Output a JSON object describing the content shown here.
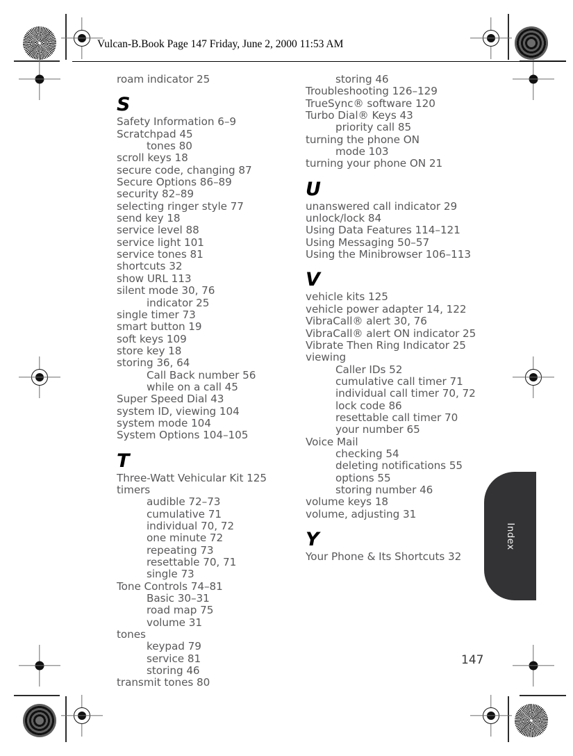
{
  "header": {
    "text": "Vulcan-B.Book  Page 147  Friday, June 2, 2000  11:53 AM"
  },
  "folio": {
    "page_number": "147"
  },
  "thumb_tab": {
    "label": "Index"
  },
  "index": {
    "left_column": [
      {
        "type": "entry",
        "text": "roam indicator 25"
      },
      {
        "type": "letter",
        "text": "S"
      },
      {
        "type": "entry",
        "text": "Safety Information 6–9"
      },
      {
        "type": "entry",
        "text": "Scratchpad 45"
      },
      {
        "type": "sub",
        "text": "tones 80"
      },
      {
        "type": "entry",
        "text": "scroll keys 18"
      },
      {
        "type": "entry",
        "text": "secure code, changing 87"
      },
      {
        "type": "entry",
        "text": "Secure Options 86–89"
      },
      {
        "type": "entry",
        "text": "security 82–89"
      },
      {
        "type": "entry",
        "text": "selecting ringer style 77"
      },
      {
        "type": "entry",
        "text": "send key 18"
      },
      {
        "type": "entry",
        "text": "service level 88"
      },
      {
        "type": "entry",
        "text": "service light 101"
      },
      {
        "type": "entry",
        "text": "service tones 81"
      },
      {
        "type": "entry",
        "text": "shortcuts 32"
      },
      {
        "type": "entry",
        "text": "show URL 113"
      },
      {
        "type": "entry",
        "text": "silent mode 30, 76"
      },
      {
        "type": "sub",
        "text": "indicator 25"
      },
      {
        "type": "entry",
        "text": "single timer 73"
      },
      {
        "type": "entry",
        "text": "smart button 19"
      },
      {
        "type": "entry",
        "text": "soft keys 109"
      },
      {
        "type": "entry",
        "text": "store key 18"
      },
      {
        "type": "entry",
        "text": "storing 36, 64"
      },
      {
        "type": "sub",
        "text": "Call Back number 56"
      },
      {
        "type": "sub",
        "text": "while on a call 45"
      },
      {
        "type": "entry",
        "text": "Super Speed Dial 43"
      },
      {
        "type": "entry",
        "text": "system ID, viewing 104"
      },
      {
        "type": "entry",
        "text": "system mode 104"
      },
      {
        "type": "entry",
        "text": "System Options 104–105"
      },
      {
        "type": "letter",
        "text": "T"
      },
      {
        "type": "entry",
        "text": "Three-Watt Vehicular Kit 125"
      },
      {
        "type": "entry",
        "text": "timers"
      },
      {
        "type": "sub",
        "text": "audible 72–73"
      },
      {
        "type": "sub",
        "text": "cumulative 71"
      },
      {
        "type": "sub",
        "text": "individual 70, 72"
      },
      {
        "type": "sub",
        "text": "one minute 72"
      },
      {
        "type": "sub",
        "text": "repeating 73"
      },
      {
        "type": "sub",
        "text": "resettable 70, 71"
      },
      {
        "type": "sub",
        "text": "single 73"
      },
      {
        "type": "entry",
        "text": "Tone Controls 74–81"
      },
      {
        "type": "sub",
        "text": "Basic 30–31"
      },
      {
        "type": "sub",
        "text": "road map 75"
      },
      {
        "type": "sub",
        "text": "volume 31"
      },
      {
        "type": "entry",
        "text": "tones"
      },
      {
        "type": "sub",
        "text": "keypad 79"
      },
      {
        "type": "sub",
        "text": "service 81"
      },
      {
        "type": "sub",
        "text": "storing 46"
      },
      {
        "type": "entry",
        "text": "transmit tones 80"
      }
    ],
    "right_column": [
      {
        "type": "sub",
        "text": "storing 46"
      },
      {
        "type": "entry",
        "text": "Troubleshooting 126–129"
      },
      {
        "type": "entry",
        "text": "TrueSync® software 120"
      },
      {
        "type": "entry",
        "text": "Turbo Dial® Keys 43"
      },
      {
        "type": "sub",
        "text": "priority call 85"
      },
      {
        "type": "entry",
        "text": "turning the phone ON"
      },
      {
        "type": "sub",
        "text": "mode 103"
      },
      {
        "type": "entry",
        "text": "turning your phone ON 21"
      },
      {
        "type": "letter",
        "text": "U"
      },
      {
        "type": "entry",
        "text": "unanswered call indicator 29"
      },
      {
        "type": "entry",
        "text": "unlock/lock 84"
      },
      {
        "type": "entry",
        "text": "Using Data Features 114–121"
      },
      {
        "type": "entry",
        "text": "Using Messaging 50–57"
      },
      {
        "type": "entry",
        "text": "Using the Minibrowser 106–113"
      },
      {
        "type": "letter",
        "text": "V"
      },
      {
        "type": "entry",
        "text": "vehicle kits 125"
      },
      {
        "type": "entry",
        "text": "vehicle power adapter 14, 122"
      },
      {
        "type": "entry",
        "text": "VibraCall® alert 30, 76"
      },
      {
        "type": "entry",
        "text": "VibraCall® alert ON indicator 25"
      },
      {
        "type": "entry",
        "text": "Vibrate Then Ring Indicator 25"
      },
      {
        "type": "entry",
        "text": "viewing"
      },
      {
        "type": "sub",
        "text": "Caller IDs 52"
      },
      {
        "type": "sub",
        "text": "cumulative call timer 71"
      },
      {
        "type": "sub",
        "text": "individual call timer 70, 72"
      },
      {
        "type": "sub",
        "text": "lock code 86"
      },
      {
        "type": "sub",
        "text": "resettable call timer 70"
      },
      {
        "type": "sub",
        "text": "your number 65"
      },
      {
        "type": "entry",
        "text": "Voice Mail"
      },
      {
        "type": "sub",
        "text": "checking 54"
      },
      {
        "type": "sub",
        "text": "deleting notifications 55"
      },
      {
        "type": "sub",
        "text": "options 55"
      },
      {
        "type": "sub",
        "text": "storing number 46"
      },
      {
        "type": "entry",
        "text": "volume keys 18"
      },
      {
        "type": "entry",
        "text": "volume, adjusting 31"
      },
      {
        "type": "letter",
        "text": "Y"
      },
      {
        "type": "entry",
        "text": "Your Phone & Its Shortcuts 32"
      }
    ]
  }
}
